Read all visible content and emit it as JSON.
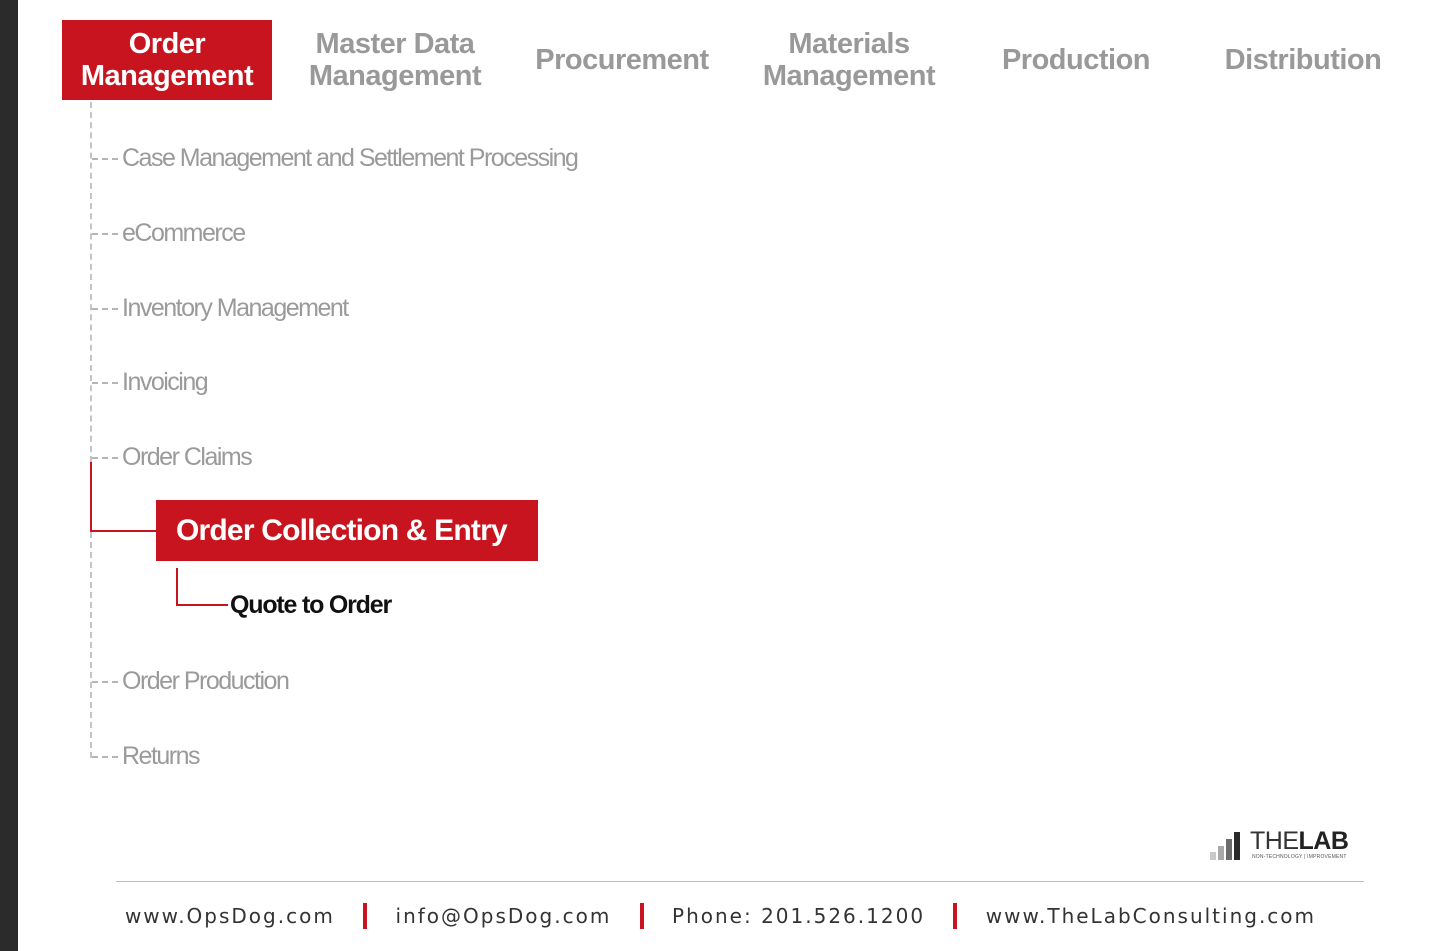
{
  "nav": {
    "tabs": [
      {
        "line1": "Order",
        "line2": "Management"
      },
      {
        "line1": "Master Data",
        "line2": "Management"
      },
      {
        "line1": "Procurement",
        "line2": ""
      },
      {
        "line1": "Materials",
        "line2": "Management"
      },
      {
        "line1": "Production",
        "line2": ""
      },
      {
        "line1": "Distribution",
        "line2": ""
      }
    ],
    "active_tab": "Order Management"
  },
  "tree": {
    "items": [
      "Case Management and Settlement Processing",
      "eCommerce",
      "Inventory Management",
      "Invoicing",
      "Order Claims"
    ],
    "selected": "Order Collection & Entry",
    "child": "Quote to Order",
    "items_after": [
      "Order Production",
      "Returns"
    ]
  },
  "logo": {
    "text_thin": "THE",
    "text_bold": "LAB",
    "tagline": "NON-TECHNOLOGY | IMPROVEMENT"
  },
  "footer": {
    "website": "www.OpsDog.com",
    "email": "info@OpsDog.com",
    "phone": "Phone: 201.526.1200",
    "website2": "www.TheLabConsulting.com"
  },
  "colors": {
    "accent": "#c8141e",
    "muted_text": "#999999",
    "dark_strip": "#2b2b2b"
  }
}
